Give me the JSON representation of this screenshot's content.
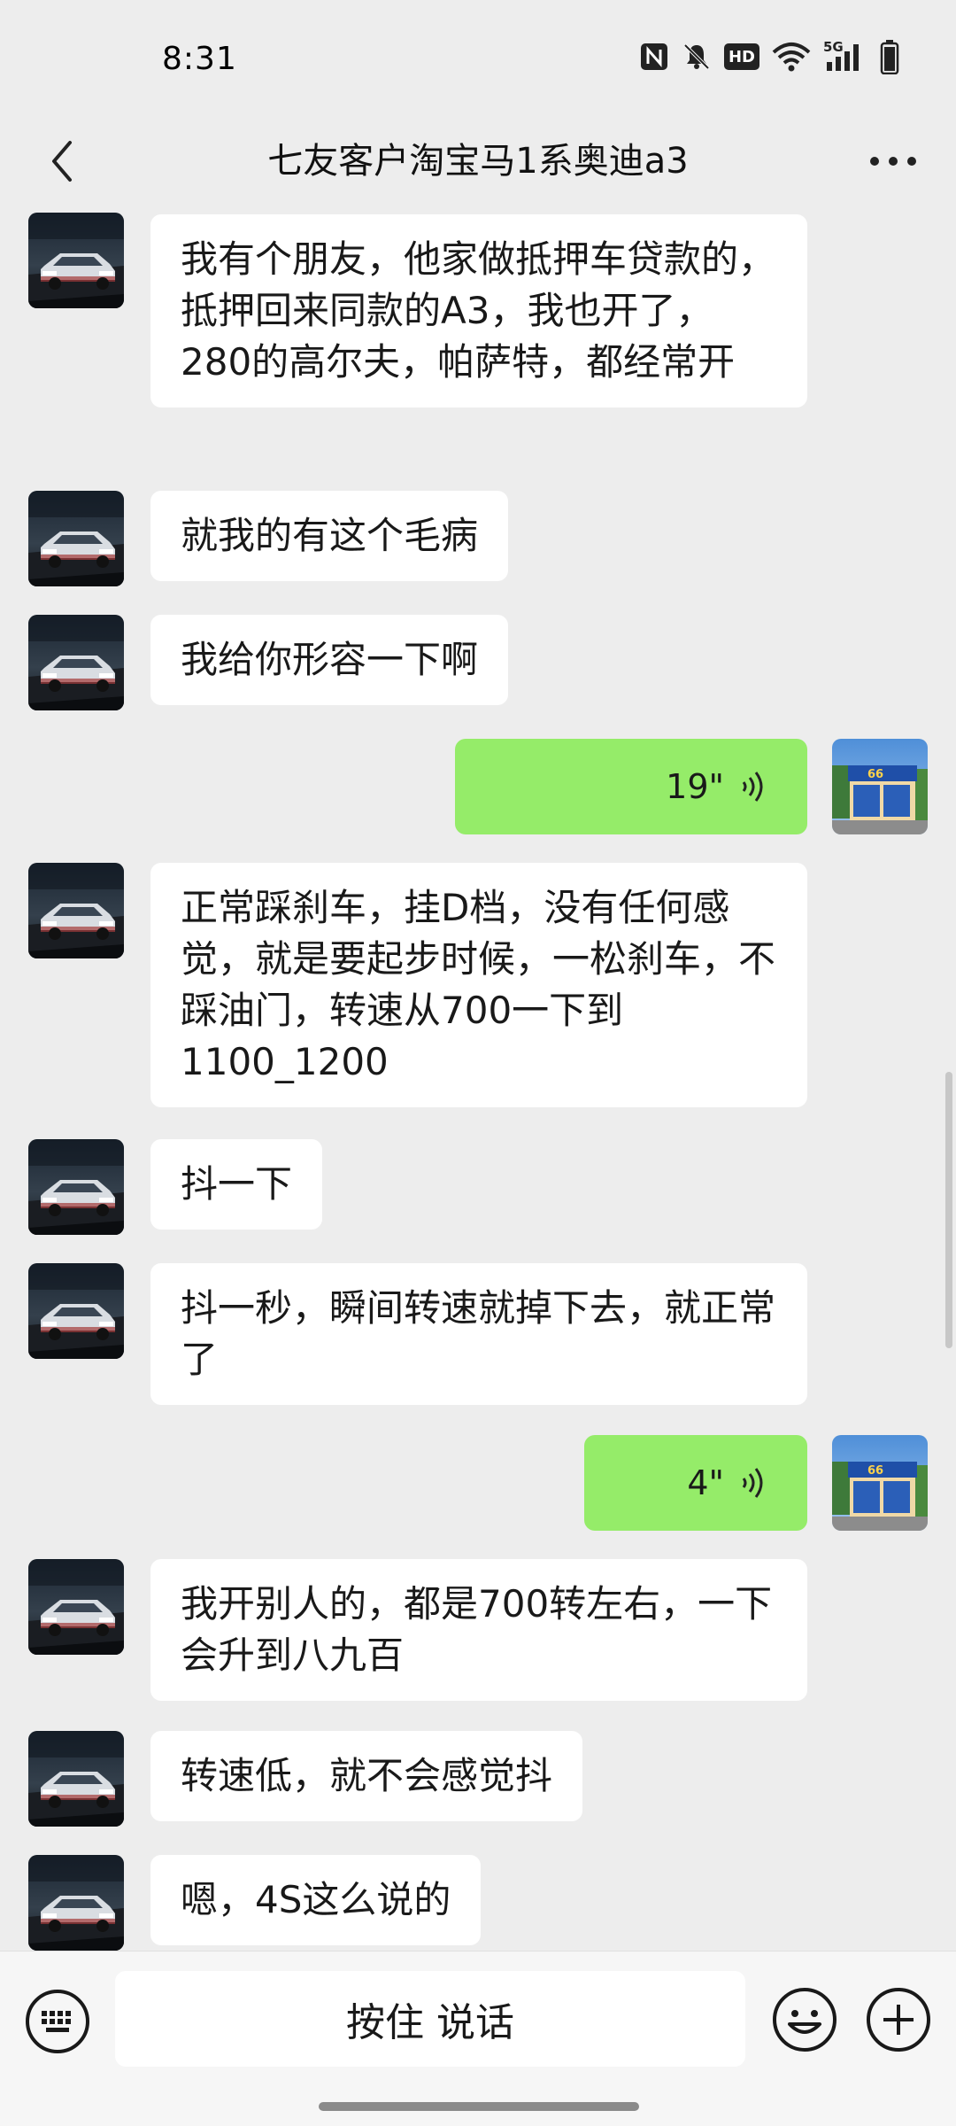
{
  "status_bar": {
    "time": "8:31",
    "icons": [
      "nfc-icon",
      "mute-bell-icon",
      "hd-icon",
      "wifi-icon",
      "5g-signal-icon",
      "battery-icon"
    ],
    "hd_label": "HD",
    "network_label": "5G"
  },
  "header": {
    "title": "七友客户淘宝马1系奥迪a3",
    "back_icon": "chevron-left-icon",
    "more_icon": "more-dots-icon"
  },
  "messages": [
    {
      "side": "in",
      "text": "我有个朋友，他家做抵押车贷款的，抵押回来同款的A3，我也开了，280的高尔夫，帕萨特，都经常开"
    },
    {
      "side": "in",
      "text": "就我的有这个毛病"
    },
    {
      "side": "in",
      "text": "我给你形容一下啊"
    },
    {
      "side": "out",
      "type": "voice",
      "duration": "19\""
    },
    {
      "side": "in",
      "text": "正常踩刹车，挂D档，没有任何感觉，就是要起步时候，一松刹车，不踩油门，转速从700一下到1100_1200"
    },
    {
      "side": "in",
      "text": "抖一下"
    },
    {
      "side": "in",
      "text": "抖一秒，瞬间转速就掉下去，就正常了"
    },
    {
      "side": "out",
      "type": "voice",
      "duration": "4\""
    },
    {
      "side": "in",
      "text": "我开别人的，都是700转左右，一下会升到八九百"
    },
    {
      "side": "in",
      "text": "转速低，就不会感觉抖"
    },
    {
      "side": "in",
      "text": "嗯，4S这么说的"
    }
  ],
  "bottom_bar": {
    "hold_to_talk": "按住 说话",
    "keyboard_icon": "keyboard-icon",
    "emoji_icon": "emoji-icon",
    "plus_icon": "plus-icon"
  },
  "colors": {
    "background": "#ededed",
    "incoming_bubble": "#ffffff",
    "outgoing_bubble": "#95ec69",
    "text": "#191919"
  }
}
